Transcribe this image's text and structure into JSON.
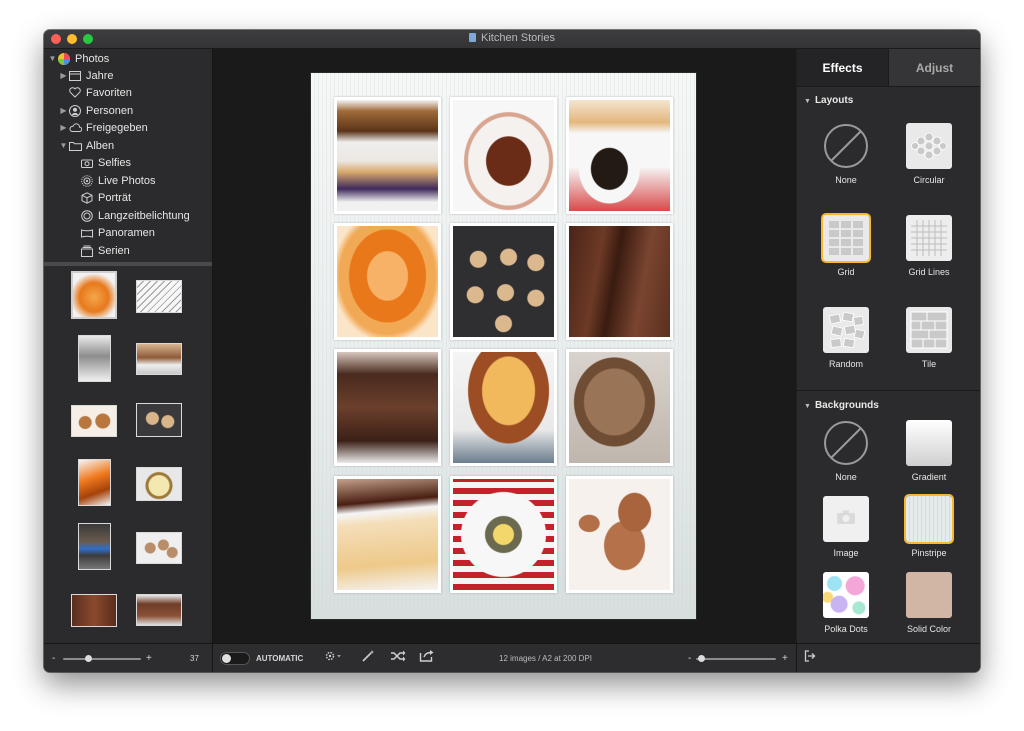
{
  "window": {
    "title": "Kitchen Stories"
  },
  "sidebar": {
    "items": [
      {
        "label": "Photos",
        "icon": "photos-app-icon",
        "expanded": true
      },
      {
        "label": "Jahre",
        "icon": "calendar-icon",
        "expanded": false
      },
      {
        "label": "Favoriten",
        "icon": "heart-icon"
      },
      {
        "label": "Personen",
        "icon": "person-icon",
        "expanded": false
      },
      {
        "label": "Freigegeben",
        "icon": "cloud-icon",
        "expanded": false
      },
      {
        "label": "Alben",
        "icon": "folder-icon",
        "expanded": true
      },
      {
        "label": "Selfies",
        "icon": "camera-icon"
      },
      {
        "label": "Live Photos",
        "icon": "live-photo-icon"
      },
      {
        "label": "Porträt",
        "icon": "cube-icon"
      },
      {
        "label": "Langzeitbelichtung",
        "icon": "long-exposure-icon"
      },
      {
        "label": "Panoramen",
        "icon": "panorama-icon"
      },
      {
        "label": "Serien",
        "icon": "burst-icon"
      }
    ]
  },
  "bottom": {
    "thumb_count": "37",
    "auto_label": "AUTOMATIC",
    "status": "12 images / A2 at 200 DPI",
    "minus": "-",
    "plus": "+"
  },
  "panel": {
    "tabs": [
      {
        "label": "Effects",
        "active": true
      },
      {
        "label": "Adjust",
        "active": false
      }
    ],
    "layouts_title": "Layouts",
    "layouts": [
      {
        "label": "None",
        "selected": false
      },
      {
        "label": "Circular",
        "selected": false
      },
      {
        "label": "Grid",
        "selected": true
      },
      {
        "label": "Grid Lines",
        "selected": false
      },
      {
        "label": "Random",
        "selected": false
      },
      {
        "label": "Tile",
        "selected": false
      }
    ],
    "backgrounds_title": "Backgrounds",
    "backgrounds": [
      {
        "label": "None",
        "selected": false
      },
      {
        "label": "Gradient",
        "selected": false
      },
      {
        "label": "Image",
        "selected": false
      },
      {
        "label": "Pinstripe",
        "selected": true
      },
      {
        "label": "Polka Dots",
        "selected": false
      },
      {
        "label": "Solid Color",
        "selected": false
      }
    ]
  },
  "colors": {
    "accent": "#f6b82f",
    "window_bg": "#1f1f21",
    "panel_bg": "#2b2b2d"
  }
}
